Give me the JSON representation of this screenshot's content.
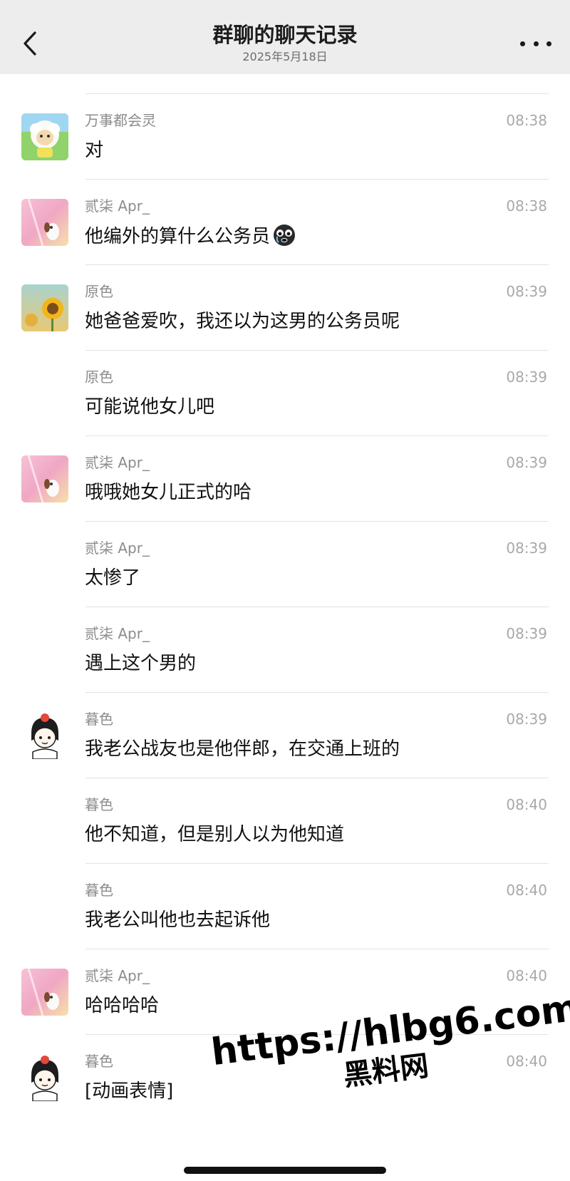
{
  "header": {
    "title": "群聊的聊天记录",
    "date": "2025年5月18日",
    "back_icon": "chevron-left-icon",
    "more_icon": "more-horizontal-icon"
  },
  "messages": [
    {
      "sender": "万事都会灵",
      "time": "08:38",
      "text": "对",
      "avatar": "sheep-avatar"
    },
    {
      "sender": "贰柒 Apr_",
      "time": "08:38",
      "text": "他编外的算什么公务员",
      "avatar": "pink-dog-avatar",
      "emoji": "crying-face-emoji"
    },
    {
      "sender": "原色",
      "time": "08:39",
      "text": "她爸爸爱吹，我还以为这男的公务员呢",
      "avatar": "sunflower-avatar"
    },
    {
      "sender": "原色",
      "time": "08:39",
      "text": "可能说他女儿吧"
    },
    {
      "sender": "贰柒 Apr_",
      "time": "08:39",
      "text": "哦哦她女儿正式的哈",
      "avatar": "pink-dog-avatar"
    },
    {
      "sender": "贰柒 Apr_",
      "time": "08:39",
      "text": "太惨了"
    },
    {
      "sender": "贰柒 Apr_",
      "time": "08:39",
      "text": "遇上这个男的"
    },
    {
      "sender": "暮色",
      "time": "08:39",
      "text": "我老公战友也是他伴郎，在交通上班的",
      "avatar": "cartoon-girl-avatar"
    },
    {
      "sender": "暮色",
      "time": "08:40",
      "text": "他不知道，但是别人以为他知道"
    },
    {
      "sender": "暮色",
      "time": "08:40",
      "text": "我老公叫他也去起诉他"
    },
    {
      "sender": "贰柒 Apr_",
      "time": "08:40",
      "text": "哈哈哈哈",
      "avatar": "pink-dog-avatar"
    },
    {
      "sender": "暮色",
      "time": "08:40",
      "text": "[动画表情]",
      "avatar": "cartoon-girl-avatar"
    }
  ],
  "watermark": {
    "url": "https://hlbg6.com",
    "label": "黑料网"
  },
  "colors": {
    "header_bg": "#ededed",
    "separator": "#e3e3e3",
    "sender_text": "#8c8c8c",
    "time_text": "#a9a9a9"
  }
}
